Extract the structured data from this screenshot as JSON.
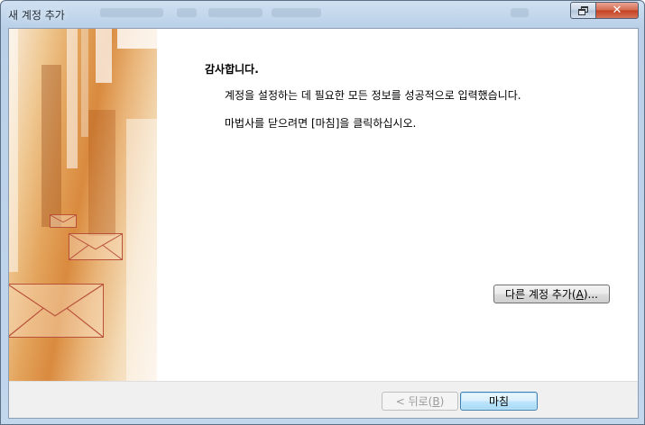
{
  "window": {
    "title": "새 계정 추가"
  },
  "content": {
    "heading": "감사합니다.",
    "message1": "계정을 설정하는 데 필요한 모든 정보를 성공적으로 입력했습니다.",
    "message2": "마법사를 닫으려면 [마침]을 클릭하십시오."
  },
  "buttons": {
    "add_account": {
      "prefix": "다른 계정 추가(",
      "accel": "A",
      "suffix": ")..."
    },
    "back": {
      "prefix": "< 뒤로(",
      "accel": "B",
      "suffix": ")"
    },
    "finish": "마침"
  },
  "icons": {
    "restore": "restore-icon",
    "close": "close-icon",
    "envelope": "envelope-icon"
  },
  "colors": {
    "title_bar": "#c2d6ec",
    "close_button": "#c2401f",
    "default_button_border": "#3c7fb1",
    "art_orange": "#d98a3e"
  }
}
